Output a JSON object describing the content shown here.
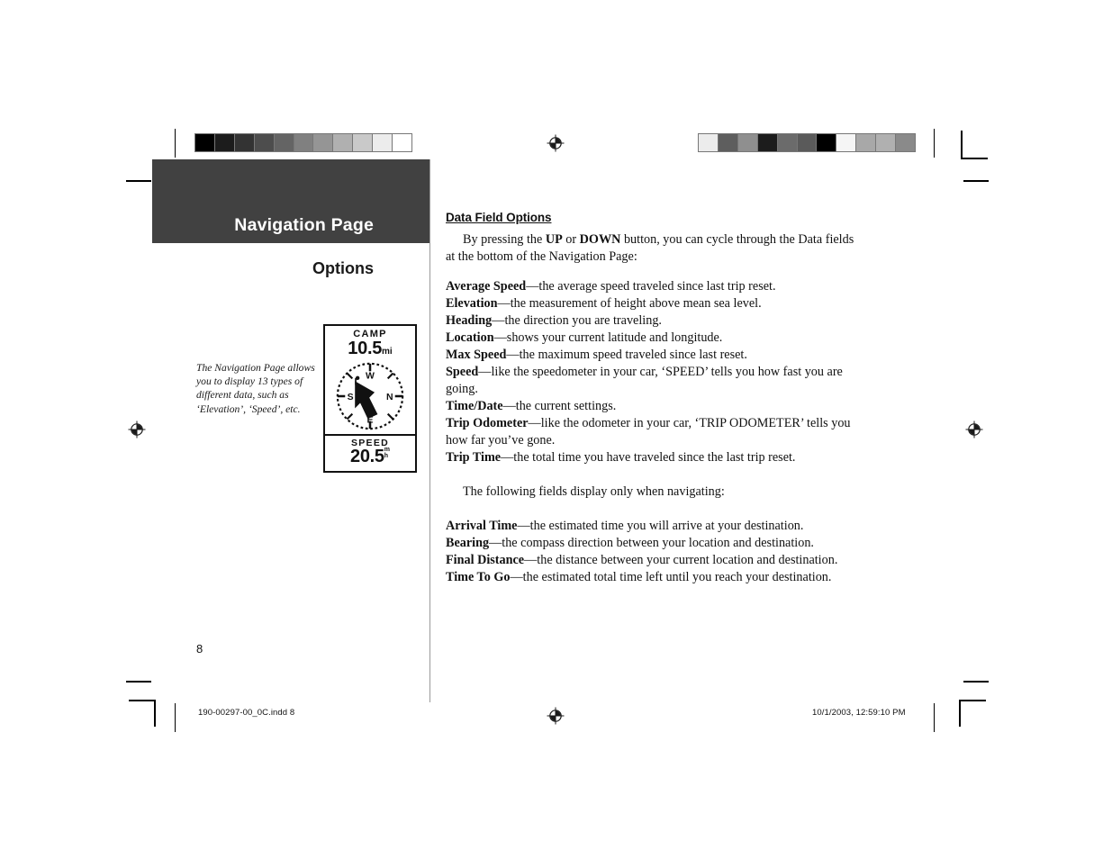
{
  "document": {
    "chapter_title": "Navigation Page",
    "section_title": "Options",
    "page_number": "8",
    "footer_left": "190-00297-00_0C.indd   8",
    "footer_right": "10/1/2003, 12:59:10 PM",
    "side_caption": "The Navigation Page allows you to display 13 types of different data, such as ‘Elevation’, ‘Speed’, etc."
  },
  "right_column": {
    "heading": "Data Field Options",
    "intro_parts": {
      "a": "By pressing the ",
      "b": "UP",
      "c": " or ",
      "d": "DOWN",
      "e": " button, you can cycle through the Data fields at the bottom of the Navigation Page:"
    },
    "fields": [
      {
        "term": "Average Speed",
        "dash": "—",
        "desc": "the average speed traveled since last trip reset."
      },
      {
        "term": "Elevation",
        "dash": "—",
        "desc": "the measurement of height above mean sea level."
      },
      {
        "term": "Heading",
        "dash": "—",
        "desc": "the direction you are traveling."
      },
      {
        "term": "Location",
        "dash": "—",
        "desc": "shows your current latitude and longitude."
      },
      {
        "term": "Max Speed",
        "dash": "—",
        "desc": "the maximum speed traveled since last reset."
      },
      {
        "term": "Speed",
        "dash": "—",
        "desc": "like the speedometer in your car, ‘SPEED’ tells you how fast you are going."
      },
      {
        "term": "Time/Date",
        "dash": "—",
        "desc": "the current settings."
      },
      {
        "term": "Trip Odometer",
        "dash": "—",
        "desc": "like the odometer in your car, ‘TRIP ODOMETER’ tells you how far you’ve gone."
      },
      {
        "term": "Trip Time",
        "dash": "—",
        "desc": "the total time you have traveled since the last trip reset."
      }
    ],
    "nav_only_intro": "The following fields display only when navigating:",
    "nav_only_fields": [
      {
        "term": "Arrival Time",
        "dash": "—",
        "desc": "the estimated time you will arrive at your destination."
      },
      {
        "term": "Bearing",
        "dash": "—",
        "desc": "the compass direction between your location and destination."
      },
      {
        "term": "Final Distance",
        "dash": "—",
        "desc": "the distance between your current location and destination."
      },
      {
        "term": "Time To Go",
        "dash": "—",
        "desc": "the estimated total time left until you reach your destination."
      }
    ]
  },
  "device_screen": {
    "destination_label": "CAMP",
    "distance_value": "10.5",
    "distance_unit": "mi",
    "speed_label": "SPEED",
    "speed_value": "20.5",
    "speed_unit_top": "m",
    "speed_unit_bottom": "h",
    "compass_marks": [
      "W",
      "N",
      "E",
      "S"
    ]
  },
  "calibration": {
    "left_swatches": [
      "#000000",
      "#1c1c1c",
      "#333333",
      "#4d4d4d",
      "#646464",
      "#808080",
      "#959595",
      "#b0b0b0",
      "#c9c9c9",
      "#ececec",
      "#ffffff"
    ],
    "right_swatches": [
      "#ececec",
      "#5e5e5e",
      "#8f8f8f",
      "#1c1c1c",
      "#6b6b6b",
      "#5a5a5a",
      "#000000",
      "#f5f5f5",
      "#a8a8a8",
      "#b0b0b0",
      "#8a8a8a"
    ]
  },
  "colors": {
    "banner_bg": "#414141",
    "text": "#111111",
    "divider": "#9a9a9a"
  }
}
